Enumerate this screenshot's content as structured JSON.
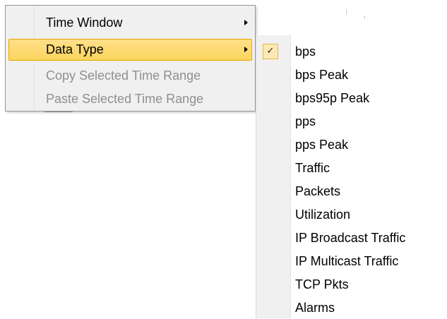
{
  "context_menu": {
    "items": [
      {
        "label": "Time Window",
        "has_submenu": true,
        "enabled": true
      },
      {
        "label": "Data Type",
        "has_submenu": true,
        "enabled": true,
        "highlighted": true
      },
      {
        "label": "Copy Selected Time Range",
        "has_submenu": false,
        "enabled": false
      },
      {
        "label": "Paste Selected Time Range",
        "has_submenu": false,
        "enabled": false
      }
    ]
  },
  "data_type_submenu": {
    "check_glyph": "✓",
    "items": [
      {
        "label": "bps",
        "checked": true
      },
      {
        "label": "bps Peak",
        "checked": false
      },
      {
        "label": "bps95p Peak",
        "checked": false
      },
      {
        "label": "pps",
        "checked": false
      },
      {
        "label": "pps Peak",
        "checked": false
      },
      {
        "label": "Traffic",
        "checked": false
      },
      {
        "label": "Packets",
        "checked": false
      },
      {
        "label": "Utilization",
        "checked": false
      },
      {
        "label": "IP Broadcast Traffic",
        "checked": false
      },
      {
        "label": "IP Multicast Traffic",
        "checked": false
      },
      {
        "label": "TCP Pkts",
        "checked": false
      },
      {
        "label": "Alarms",
        "checked": false
      }
    ]
  },
  "colors": {
    "highlight": "#ffd86b",
    "highlight_border": "#e5a600",
    "menu_bg": "#f0f0f0",
    "disabled_text": "#8f8f8f"
  }
}
